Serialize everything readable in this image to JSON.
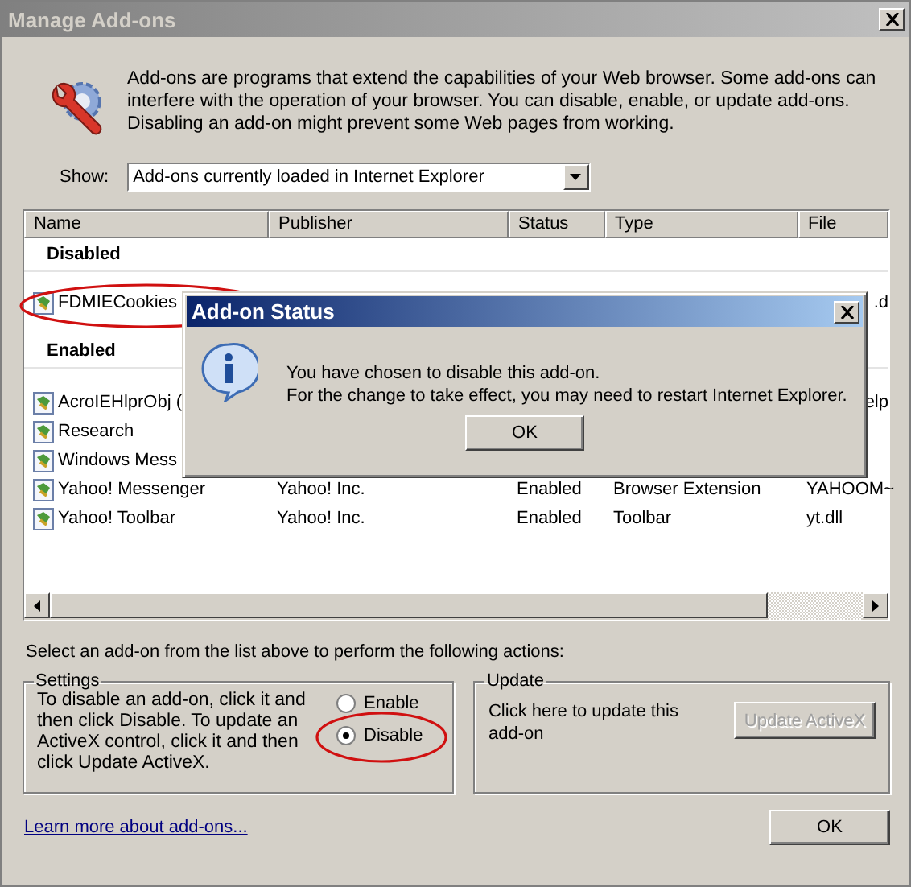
{
  "window": {
    "title": "Manage Add-ons"
  },
  "intro": "Add-ons are programs that extend the capabilities of your Web browser. Some add-ons can interfere with the operation of your browser. You can disable, enable, or update add-ons. Disabling an add-on might prevent some Web pages from working.",
  "show": {
    "label": "Show:",
    "value": "Add-ons currently loaded in Internet Explorer"
  },
  "table": {
    "columns": [
      "Name",
      "Publisher",
      "Status",
      "Type",
      "File"
    ],
    "groups": [
      {
        "title": "Disabled",
        "rows": [
          {
            "name": "FDMIECookies",
            "file_tail": ".d",
            "highlighted": true
          }
        ]
      },
      {
        "title": "Enabled",
        "rows": [
          {
            "name": "AcroIEHlprObj (",
            "file_tail": "elp",
            "highlighted": false
          },
          {
            "name": "Research",
            "highlighted": false
          },
          {
            "name": "Windows Mess",
            "highlighted": false
          },
          {
            "name": "Yahoo! Messenger",
            "publisher": "Yahoo! Inc.",
            "status": "Enabled",
            "type": "Browser Extension",
            "file": "YAHOOM~",
            "highlighted": false
          },
          {
            "name": "Yahoo! Toolbar",
            "publisher": "Yahoo! Inc.",
            "status": "Enabled",
            "type": "Toolbar",
            "file": "yt.dll",
            "highlighted": false
          }
        ]
      }
    ]
  },
  "instructions": "Select an add-on from the list above to perform the following actions:",
  "settings": {
    "title": "Settings",
    "text": "To disable an add-on, click it and then click Disable. To update an ActiveX control, click it and then click Update ActiveX.",
    "options": [
      {
        "label": "Enable",
        "selected": false,
        "highlighted": false
      },
      {
        "label": "Disable",
        "selected": true,
        "highlighted": true
      }
    ]
  },
  "update": {
    "title": "Update",
    "text": "Click here to update this add-on",
    "button": {
      "label": "Update ActiveX",
      "disabled": true
    }
  },
  "link": "Learn more about add-ons...",
  "ok_button": "OK",
  "dialog": {
    "title": "Add-on Status",
    "lines": [
      "You have chosen to disable this add-on.",
      "For the change to take effect, you may need to restart Internet Explorer."
    ],
    "button": "OK"
  }
}
